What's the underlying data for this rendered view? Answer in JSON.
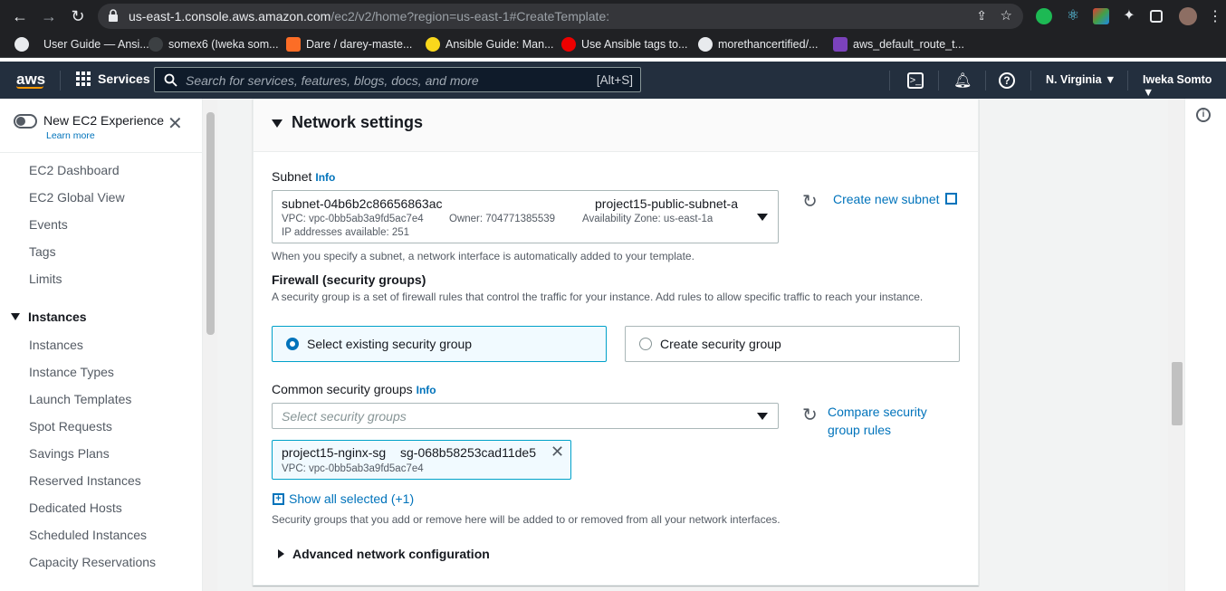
{
  "browser": {
    "url_host": "us-east-1.console.aws.amazon.com",
    "url_path": "/ec2/v2/home?region=us-east-1#CreateTemplate:",
    "bookmarks": [
      "User Guide — Ansi...",
      "somex6 (Iweka som...",
      "Dare / darey-maste...",
      "Ansible Guide: Man...",
      "Use Ansible tags to...",
      "morethancertified/...",
      "aws_default_route_t..."
    ]
  },
  "aws": {
    "logo": "aws",
    "services_label": "Services",
    "search_placeholder": "Search for services, features, blogs, docs, and more",
    "search_shortcut": "[Alt+S]",
    "region": "N. Virginia ▼",
    "user": "Iweka Somto ▼"
  },
  "sidebar": {
    "new_experience": "New EC2 Experience",
    "learn_more": "Learn more",
    "items_top": [
      "EC2 Dashboard",
      "EC2 Global View",
      "Events",
      "Tags",
      "Limits"
    ],
    "section_instances": "Instances",
    "items_instances": [
      "Instances",
      "Instance Types",
      "Launch Templates",
      "Spot Requests",
      "Savings Plans",
      "Reserved Instances",
      "Dedicated Hosts",
      "Scheduled Instances",
      "Capacity Reservations"
    ]
  },
  "network": {
    "title": "Network settings",
    "subnet_label": "Subnet",
    "info": "Info",
    "subnet_id": "subnet-04b6b2c86656863ac",
    "subnet_name": "project15-public-subnet-a",
    "subnet_vpc": "VPC: vpc-0bb5ab3a9fd5ac7e4",
    "subnet_owner": "Owner: 704771385539",
    "subnet_az": "Availability Zone: us-east-1a",
    "subnet_ips": "IP addresses available: 251",
    "create_subnet": "Create new subnet",
    "subnet_help": "When you specify a subnet, a network interface is automatically added to your template.",
    "firewall_title": "Firewall (security groups)",
    "firewall_desc": "A security group is a set of firewall rules that control the traffic for your instance. Add rules to allow specific traffic to reach your instance.",
    "option_existing": "Select existing security group",
    "option_create": "Create security group",
    "common_sg_label": "Common security groups",
    "sg_placeholder": "Select security groups",
    "compare_line1": "Compare security",
    "compare_line2": "group rules",
    "token_name": "project15-nginx-sg",
    "token_id": "sg-068b58253cad11de5",
    "token_vpc": "VPC: vpc-0bb5ab3a9fd5ac7e4",
    "show_all": "Show all selected (+1)",
    "sg_help": "Security groups that you add or remove here will be added to or removed from all your network interfaces.",
    "advanced": "Advanced network configuration"
  },
  "colors": {
    "aws_nav": "#232f3e",
    "link": "#0073bb",
    "selected_border": "#00a1c9"
  }
}
